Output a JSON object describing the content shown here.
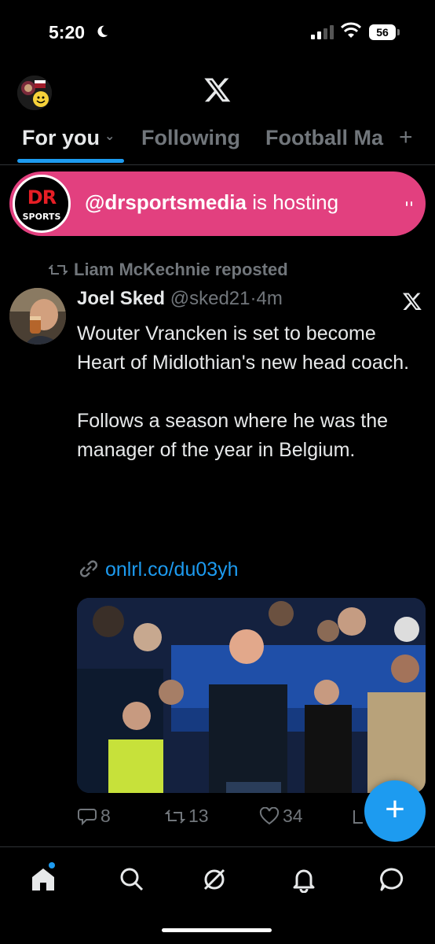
{
  "status_bar": {
    "time": "5:20",
    "battery": "56"
  },
  "header": {
    "logo": "x-logo-icon"
  },
  "tabs": [
    {
      "label": "For you",
      "active": true
    },
    {
      "label": "Following",
      "active": false
    },
    {
      "label": "Football Ma",
      "active": false
    }
  ],
  "tabs_add": "+",
  "space": {
    "avatar_top": "DR",
    "avatar_bottom": "SPORTS",
    "host": "@drsportsmedia",
    "suffix": " is hosting",
    "color": "#e2407f"
  },
  "tweet": {
    "reposted_by": "Liam McKechnie reposted",
    "author_name": "Joel Sked",
    "author_handle": "@sked21",
    "separator": "·",
    "time": "4m",
    "paragraphs": [
      "Wouter Vrancken is set to become Heart of Midlothian's new head coach.",
      "Follows a season where he was the manager of the year in Belgium."
    ],
    "link": "onlrl.co/du03yh",
    "actions": {
      "replies": "8",
      "reposts": "13",
      "likes": "34"
    }
  },
  "fab_label": "+",
  "bottom_nav": [
    "home-icon",
    "search-icon",
    "grok-icon",
    "notifications-icon",
    "messages-icon"
  ],
  "colors": {
    "accent": "#1d9bf0",
    "background": "#000000",
    "muted": "#71767b"
  }
}
